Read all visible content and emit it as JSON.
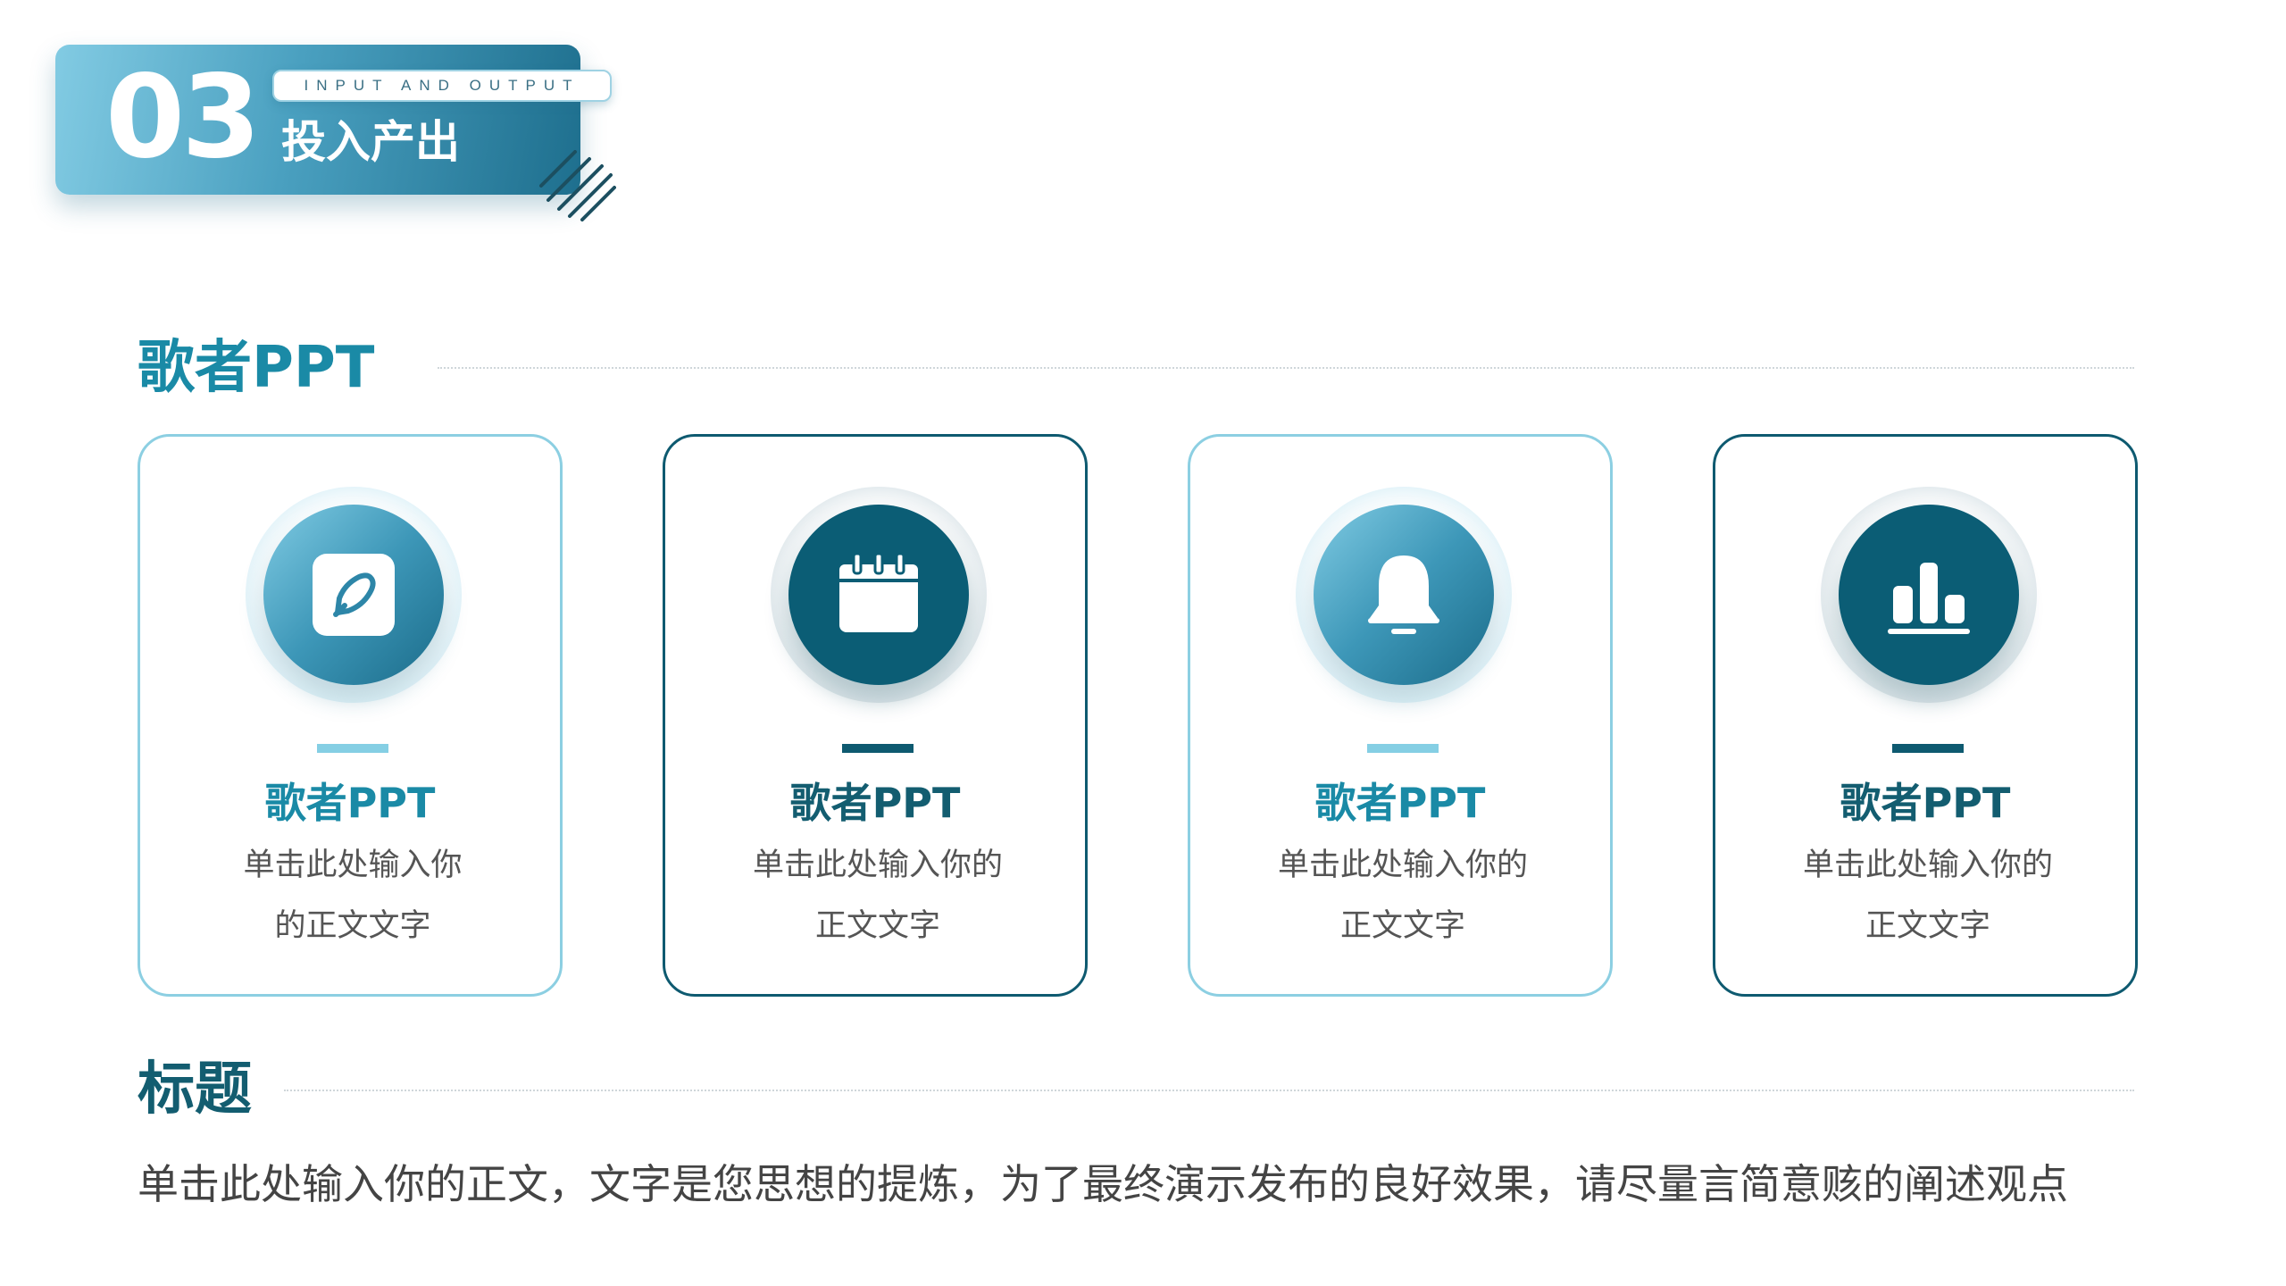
{
  "header": {
    "number": "03",
    "subtitle_en": "INPUT AND OUTPUT",
    "title": "投入产出"
  },
  "section1": {
    "title": "歌者PPT"
  },
  "cards": [
    {
      "icon": "edit-icon",
      "title": "歌者PPT",
      "lines": [
        "单击此处输入你",
        "的正文文字"
      ]
    },
    {
      "icon": "calendar-icon",
      "title": "歌者PPT",
      "lines": [
        "单击此处输入你的",
        "正文文字"
      ]
    },
    {
      "icon": "bell-icon",
      "title": "歌者PPT",
      "lines": [
        "单击此处输入你的",
        "正文文字"
      ]
    },
    {
      "icon": "bar-chart-icon",
      "title": "歌者PPT",
      "lines": [
        "单击此处输入你的",
        "正文文字"
      ]
    }
  ],
  "section2": {
    "title": "标题",
    "body": "单击此处输入你的正文，文字是您思想的提炼，为了最终演示发布的良好效果，请尽量言简意赅的阐述观点"
  },
  "colors": {
    "primary_light": "#1a8aa6",
    "primary_dark": "#135d70",
    "accent_light": "#85cfe4"
  }
}
